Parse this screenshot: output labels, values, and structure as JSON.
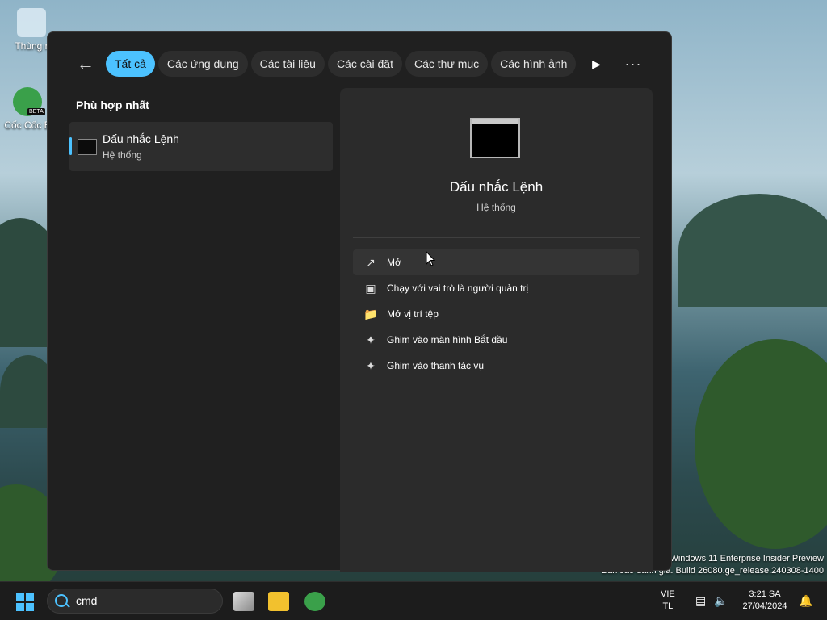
{
  "desktop": {
    "icons": [
      {
        "label": "Thùng r"
      },
      {
        "label": "Cốc Cốc B",
        "badge": "BETA"
      }
    ],
    "watermark": {
      "line1": "Windows 11 Enterprise Insider Preview",
      "line2": "Bản sao đánh giá. Build 26080.ge_release.240308-1400"
    }
  },
  "search_panel": {
    "filters": [
      "Tất cả",
      "Các ứng dụng",
      "Các tài liệu",
      "Các cài đặt",
      "Các thư mục",
      "Các hình ảnh"
    ],
    "active_filter": "Tất cả",
    "section_title": "Phù hợp nhất",
    "best_match": {
      "name": "Dấu nhắc Lệnh",
      "type": "Hệ thống"
    },
    "detail": {
      "name": "Dấu nhắc Lệnh",
      "type": "Hệ thống",
      "actions": [
        {
          "label": "Mở",
          "icon": "open-external-icon"
        },
        {
          "label": "Chạy với vai trò là người quản trị",
          "icon": "admin-shield-icon"
        },
        {
          "label": "Mở vị trí tệp",
          "icon": "folder-icon"
        },
        {
          "label": "Ghim vào màn hình Bắt đầu",
          "icon": "pin-icon"
        },
        {
          "label": "Ghim vào thanh tác vụ",
          "icon": "pin-icon"
        }
      ]
    }
  },
  "taskbar": {
    "search_value": "cmd",
    "language": {
      "line1": "VIE",
      "line2": "TL"
    },
    "clock": {
      "time": "3:21 SA",
      "date": "27/04/2024"
    }
  },
  "colors": {
    "accent": "#4cc2ff",
    "panel_bg": "#202020",
    "detail_bg": "#2b2b2b"
  }
}
